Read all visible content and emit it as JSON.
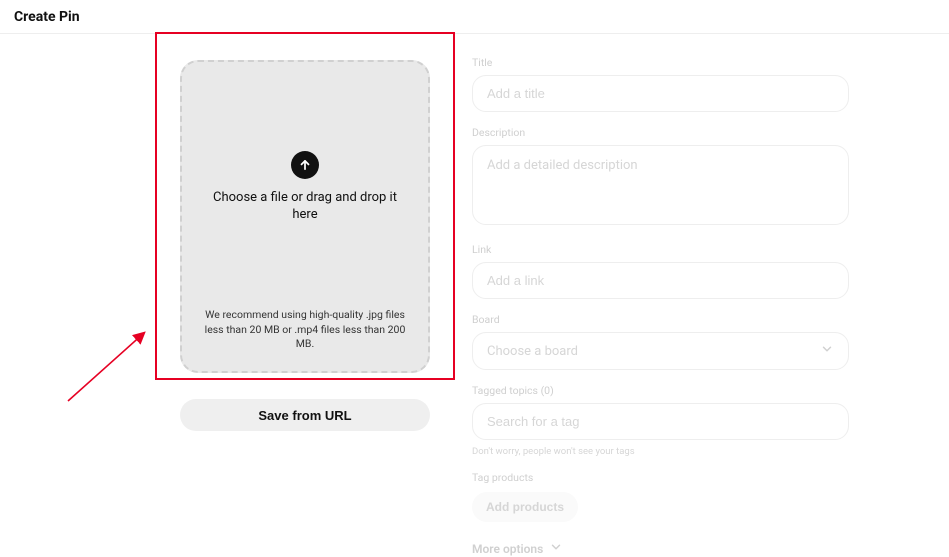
{
  "header": {
    "title": "Create Pin"
  },
  "upload": {
    "main_text": "Choose a file or drag and drop it here",
    "hint_text": "We recommend using high-quality .jpg files less than 20 MB or .mp4 files less than 200 MB.",
    "url_button_label": "Save from URL"
  },
  "form": {
    "title": {
      "label": "Title",
      "placeholder": "Add a title"
    },
    "description": {
      "label": "Description",
      "placeholder": "Add a detailed description"
    },
    "link": {
      "label": "Link",
      "placeholder": "Add a link"
    },
    "board": {
      "label": "Board",
      "placeholder": "Choose a board"
    },
    "tagged_topics": {
      "label": "Tagged topics (0)",
      "placeholder": "Search for a tag",
      "helper": "Don't worry, people won't see your tags"
    },
    "tag_products": {
      "label": "Tag products",
      "button": "Add products"
    },
    "more_options": "More options"
  }
}
